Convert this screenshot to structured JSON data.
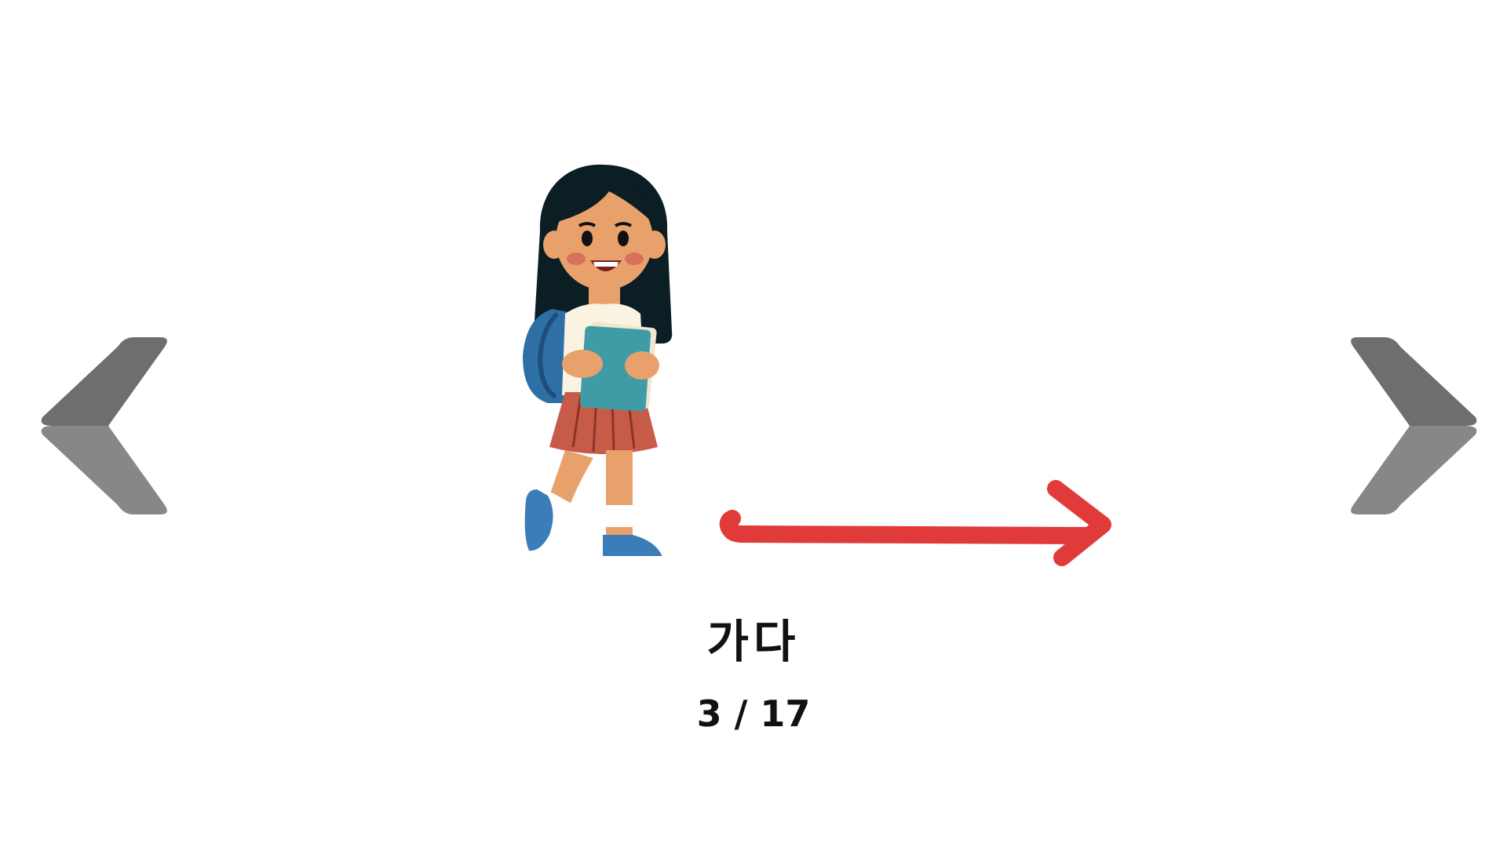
{
  "slide": {
    "word": "가다",
    "position": {
      "current": 3,
      "total": 17,
      "label": "3 / 17"
    }
  },
  "navigation": {
    "previous_icon": "chevron-left-icon",
    "next_icon": "chevron-right-icon",
    "color_dark": "#6E6E70",
    "color_light": "#878789"
  },
  "illustration": {
    "subject": "girl-walking-with-books-icon",
    "direction_arrow_color": "#E03A3A"
  }
}
